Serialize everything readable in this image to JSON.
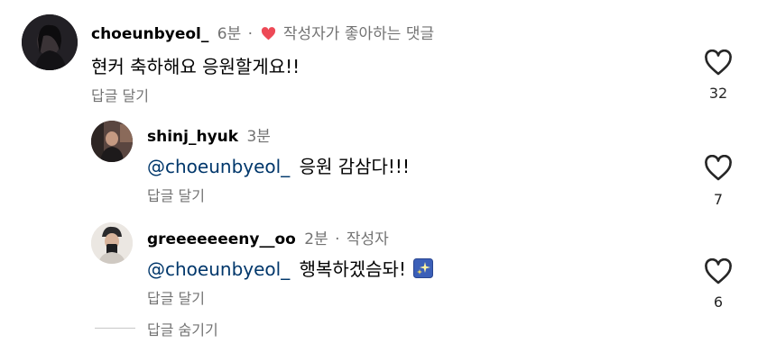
{
  "comments": [
    {
      "username": "choeunbyeol_",
      "time": "6분",
      "separator": "·",
      "badge": "작성자가 좋아하는 댓글",
      "text": "현커 축하해요 응원할게요!!",
      "reply_label": "답글 달기",
      "like_count": "32"
    }
  ],
  "replies": [
    {
      "username": "shinj_hyuk",
      "time": "3분",
      "mention": "@choeunbyeol_",
      "text": "응원 감삼다!!!",
      "reply_label": "답글 달기",
      "like_count": "7"
    },
    {
      "username": "greeeeeeeny__oo",
      "time": "2분",
      "separator": "·",
      "badge": "작성자",
      "mention": "@choeunbyeol_",
      "text": "행복하겠슴돠!",
      "reply_label": "답글 달기",
      "like_count": "6"
    }
  ],
  "hide_replies_label": "답글 숨기기",
  "colors": {
    "heart": "#ed4956",
    "mention": "#00376b",
    "meta": "#737373"
  }
}
